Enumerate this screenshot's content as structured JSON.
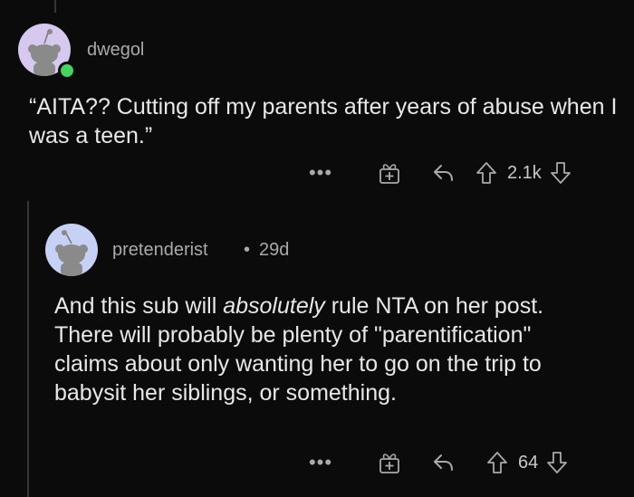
{
  "comment1": {
    "username": "dwegol",
    "body": "“AITA?? Cutting off my parents after years of abuse when I was a teen.”",
    "score": "2.1k",
    "more_label": "•••"
  },
  "comment2": {
    "username": "pretenderist",
    "separator": "•",
    "age": "29d",
    "body_before": "And this sub will ",
    "body_emphasis": "absolutely",
    "body_after": " rule NTA on her post. There will probably be plenty of \"parentification\" claims about only wanting her to go on the trip to babysit her siblings, or something.",
    "score": "64",
    "more_label": "•••"
  },
  "icons": [
    "more-icon",
    "award-icon",
    "reply-icon",
    "upvote-icon",
    "downvote-icon"
  ],
  "colors": {
    "background": "#0b0b0c",
    "online": "#46d160",
    "avatar1": "#d6c8ef",
    "avatar2": "#c7d1f5"
  }
}
